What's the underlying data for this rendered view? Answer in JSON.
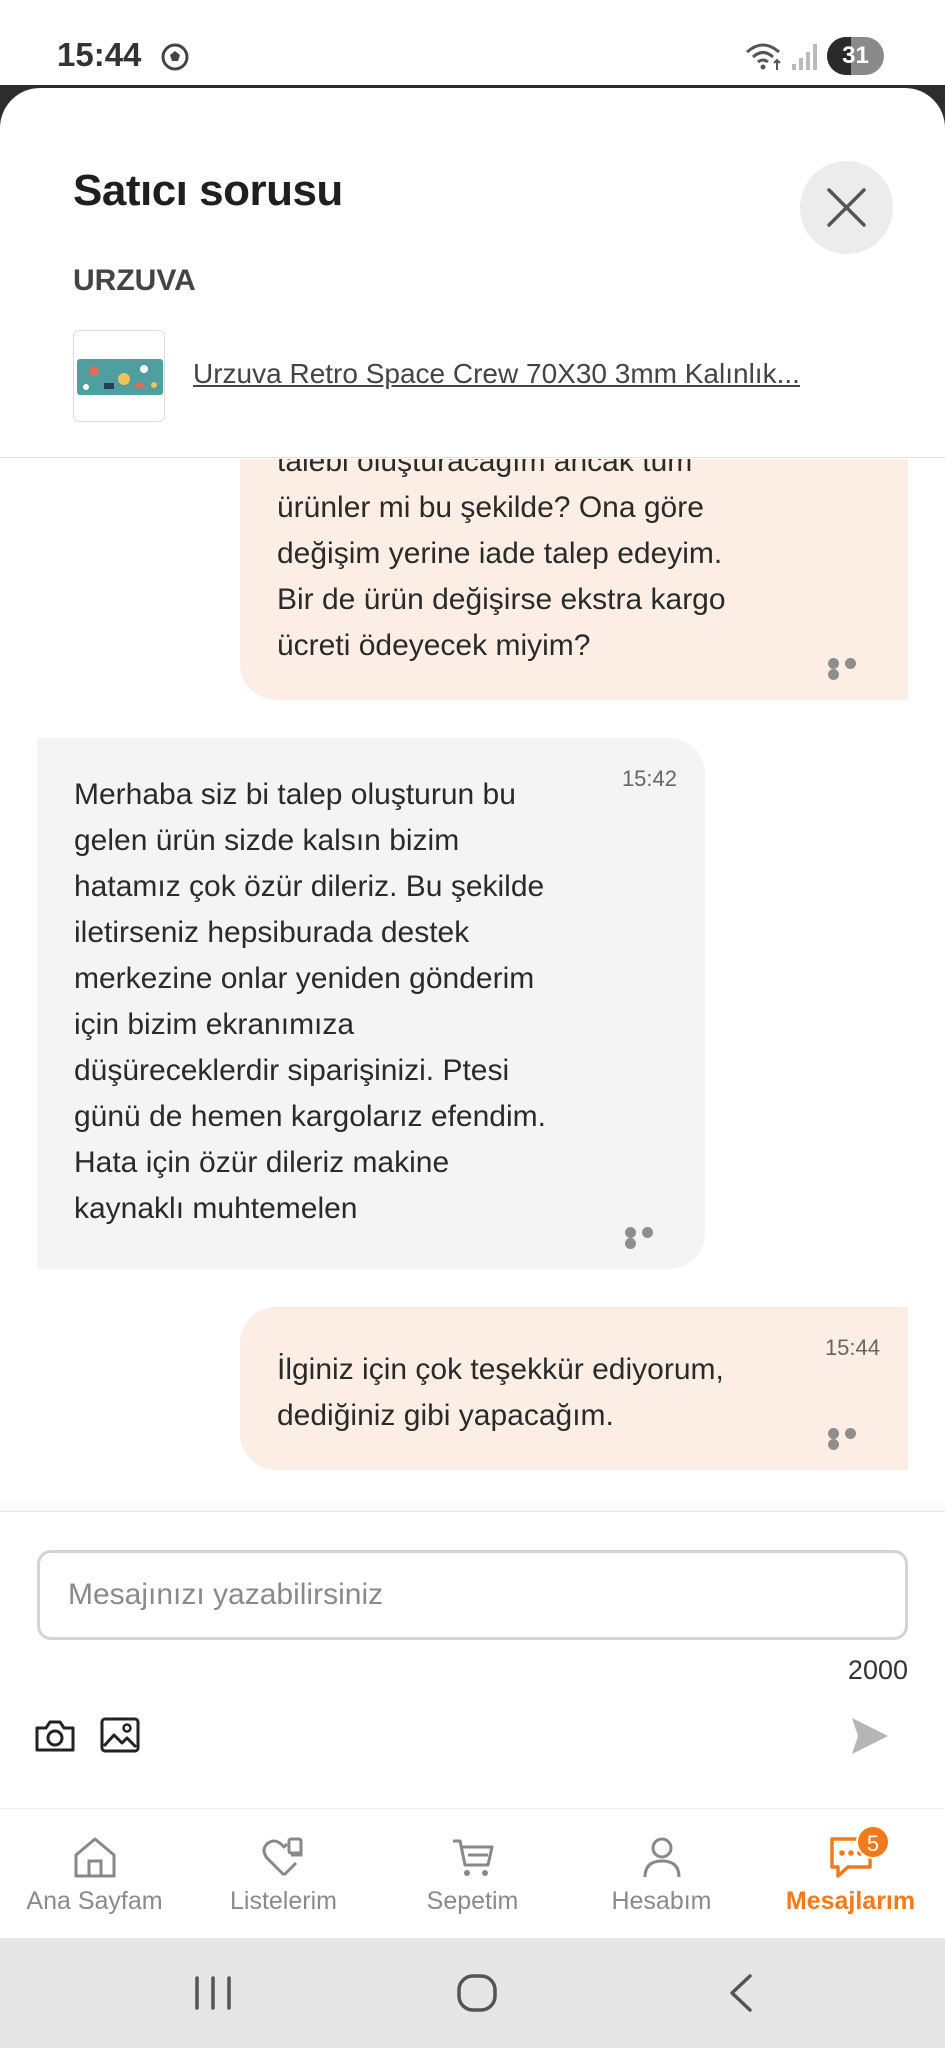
{
  "status_bar": {
    "time": "15:44",
    "battery": "31",
    "battery_level": 0.31
  },
  "header": {
    "title": "Satıcı sorusu",
    "seller": "URZUVA",
    "product_title": "Urzuva Retro Space Crew 70X30 3mm Kalınlık..."
  },
  "messages": [
    {
      "direction": "outgoing",
      "text": "talebi oluşturacağım ancak tüm\nürünler mi bu şekilde? Ona göre\ndeğişim yerine iade talep edeyim.\nBir de ürün değişirse ekstra kargo\nücreti ödeyecek miyim?"
    },
    {
      "direction": "incoming",
      "time": "15:42",
      "text": "Merhaba siz bi talep oluşturun bu\ngelen ürün sizde kalsın bizim\nhatamız çok özür dileriz. Bu şekilde\niletirseniz hepsiburada destek\nmerkezine onlar yeniden gönderim\niçin bizim ekranımıza\ndüşüreceklerdir siparişinizi. Ptesi\ngünü de hemen kargolarız efendim.\nHata için özür dileriz makine\nkaynaklı muhtemelen"
    },
    {
      "direction": "outgoing",
      "time": "15:44",
      "text": "İlginiz için çok teşekkür ediyorum,\ndediğiniz gibi yapacağım."
    }
  ],
  "composer": {
    "placeholder": "Mesajınızı yazabilirsiniz",
    "char_limit": "2000"
  },
  "nav": {
    "items": [
      {
        "label": "Ana Sayfam",
        "icon": "home-icon"
      },
      {
        "label": "Listelerim",
        "icon": "heart-list-icon"
      },
      {
        "label": "Sepetim",
        "icon": "cart-icon"
      },
      {
        "label": "Hesabım",
        "icon": "user-icon"
      },
      {
        "label": "Mesajlarım",
        "icon": "chat-icon",
        "badge": "5",
        "active": true
      }
    ]
  },
  "colors": {
    "accent": "#f27a1a",
    "outgoing_bubble": "#fdeee5",
    "incoming_bubble": "#f4f4f4"
  }
}
